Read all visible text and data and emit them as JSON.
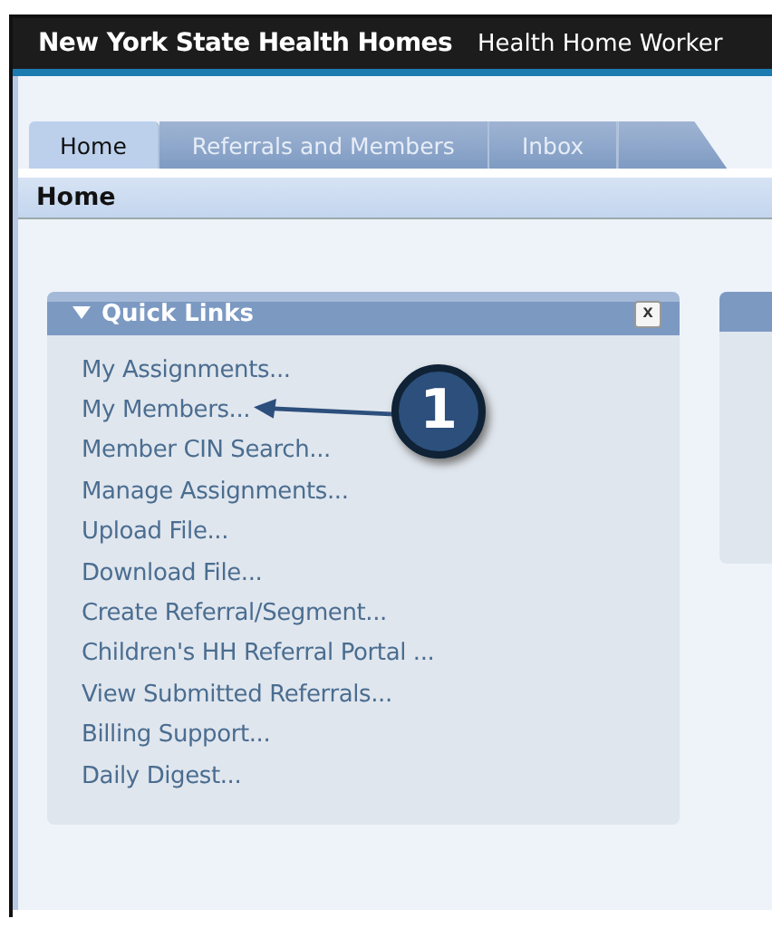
{
  "header": {
    "title": "New York State Health Homes",
    "role": "Health Home Worker"
  },
  "tabs": [
    {
      "label": "Home",
      "selected": true
    },
    {
      "label": "Referrals and Members",
      "selected": false
    },
    {
      "label": "Inbox",
      "selected": false
    }
  ],
  "page_title": "Home",
  "quick_links": {
    "title": "Quick Links",
    "expanded": true,
    "close": "x",
    "links": [
      {
        "text": "My Assignments..."
      },
      {
        "text": "My Members...",
        "callout": "1"
      },
      {
        "text": "Member CIN Search..."
      },
      {
        "text": "Manage Assignments..."
      },
      {
        "text": "Upload File..."
      },
      {
        "text": "Download File..."
      },
      {
        "text": "Create Referral/Segment..."
      },
      {
        "text": "Children's HH Referral Portal ..."
      },
      {
        "text": "View Submitted Referrals..."
      },
      {
        "text": "Billing Support..."
      },
      {
        "text": "Daily Digest..."
      }
    ]
  }
}
